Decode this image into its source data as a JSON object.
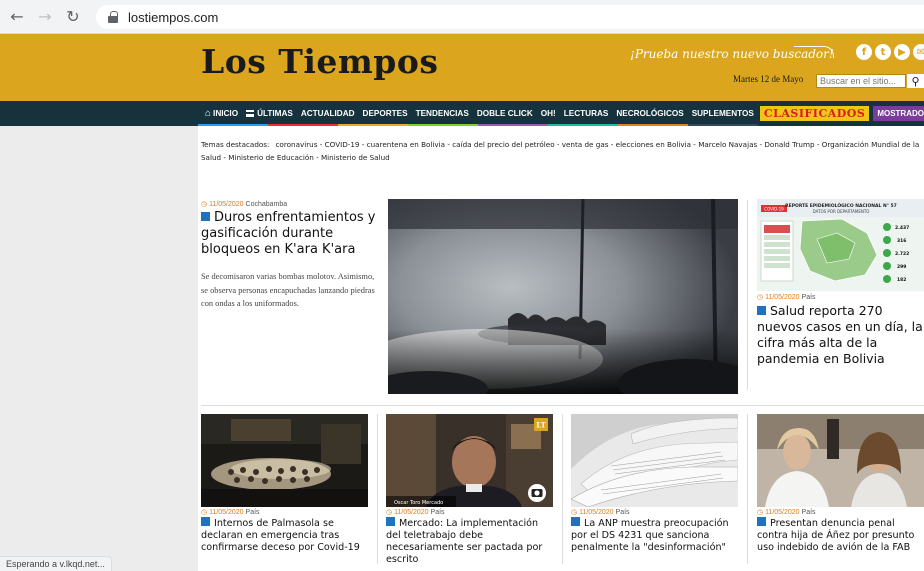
{
  "browser": {
    "url": "lostiempos.com",
    "status": "Esperando a v.lkqd.net..."
  },
  "header": {
    "logo": "Los Tiempos",
    "promo": "¡Prueba nuestro nuevo buscador!",
    "date": "Martes 12 de Mayo",
    "search_placeholder": "Buscar en el sitio...",
    "socials": [
      "f",
      "t",
      "▶",
      "✉"
    ]
  },
  "nav": {
    "items": [
      "INICIO",
      "ÚLTIMAS",
      "ACTUALIDAD",
      "DEPORTES",
      "TENDENCIAS",
      "DOBLE CLICK",
      "OH!",
      "LECTURAS",
      "NECROLÓGICOS",
      "SUPLEMENTOS"
    ],
    "clasificados": "CLASIFICADOS",
    "mostrador": "MOSTRADOR"
  },
  "topics": {
    "label": "Temas destacados:",
    "line": "coronavirus  -  COVID-19  -  cuarentena en Bolivia  -  caída del precio del petróleo  -  venta de gas  -  elecciones en Bolivia  -  Marcelo Navajas  -  Donald Trump  -  Organización Mundial de la Salud  -  Ministerio de Educación  -  Ministerio de Salud"
  },
  "main_story": {
    "date": "11/05/2020",
    "section": "Cochabamba",
    "title": "Duros enfrentamientos y gasificación durante bloqueos en K'ara K'ara",
    "desc": "Se decomisaron varias bombas molotov. Asimismo, se observa personas encapuchadas lanzando piedras con ondas a los uniformados."
  },
  "side_story": {
    "date": "11/05/2020",
    "section": "País",
    "title": "Salud reporta 270 nuevos casos en un día, la cifra más alta de la pandemia en Bolivia",
    "infographic_title": "REPORTE EPIDEMIOLÓGICO NACIONAL N° 57",
    "infographic_sub": "DATOS POR DEPARTAMENTO",
    "infographic_tag": "COVID-19",
    "infographic_values": [
      "2.437",
      "316",
      "2.722",
      "299",
      "182"
    ]
  },
  "cards": [
    {
      "date": "11/05/2020",
      "section": "País",
      "title": "Internos de Palmasola se declaran en emergencia tras confirmarse deceso por Covid-19"
    },
    {
      "date": "11/05/2020",
      "section": "País",
      "title": "Mercado: La implementación del teletrabajo debe necesariamente ser pactada por escrito",
      "caption": "Oscar Toro Mercado",
      "badge": "LT"
    },
    {
      "date": "11/05/2020",
      "section": "País",
      "title": "La ANP muestra preocupación por el DS 4231 que sanciona penalmente la \"desinformación\""
    },
    {
      "date": "11/05/2020",
      "section": "País",
      "title": "Presentan denuncia penal contra hija de Áñez por presunto uso indebido de avión de la FAB"
    }
  ],
  "colors": {
    "brand_gold": "#dba61e",
    "nav_dark": "#16323d",
    "accent_blue": "#1e73be",
    "date_orange": "#e07a1a",
    "clasificados_yellow": "#f0c514",
    "mostrador_purple": "#7a3b9b"
  }
}
